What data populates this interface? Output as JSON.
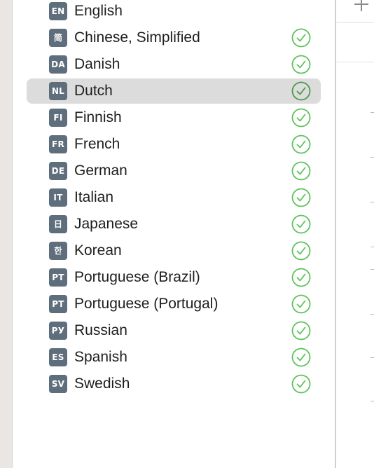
{
  "languages": [
    {
      "code": "EN",
      "name": "English",
      "status": "none",
      "selected": false
    },
    {
      "code": "简",
      "name": "Chinese, Simplified",
      "status": "complete",
      "selected": false
    },
    {
      "code": "DA",
      "name": "Danish",
      "status": "complete",
      "selected": false
    },
    {
      "code": "NL",
      "name": "Dutch",
      "status": "complete",
      "selected": true
    },
    {
      "code": "FI",
      "name": "Finnish",
      "status": "complete",
      "selected": false
    },
    {
      "code": "FR",
      "name": "French",
      "status": "complete",
      "selected": false
    },
    {
      "code": "DE",
      "name": "German",
      "status": "complete",
      "selected": false
    },
    {
      "code": "IT",
      "name": "Italian",
      "status": "complete",
      "selected": false
    },
    {
      "code": "日",
      "name": "Japanese",
      "status": "complete",
      "selected": false
    },
    {
      "code": "한",
      "name": "Korean",
      "status": "complete",
      "selected": false
    },
    {
      "code": "PT",
      "name": "Portuguese (Brazil)",
      "status": "complete",
      "selected": false
    },
    {
      "code": "PT",
      "name": "Portuguese (Portugal)",
      "status": "complete",
      "selected": false
    },
    {
      "code": "РУ",
      "name": "Russian",
      "status": "complete",
      "selected": false
    },
    {
      "code": "ES",
      "name": "Spanish",
      "status": "complete",
      "selected": false
    },
    {
      "code": "SV",
      "name": "Swedish",
      "status": "complete",
      "selected": false
    }
  ],
  "icons": {
    "status_complete": "check-circle-icon",
    "add": "plus-icon"
  },
  "colors": {
    "check_green": "#5cc35a",
    "check_green_selected": "#4a9a4a",
    "badge_bg": "#5f6e7c",
    "selection_bg": "#dcdcdc"
  }
}
